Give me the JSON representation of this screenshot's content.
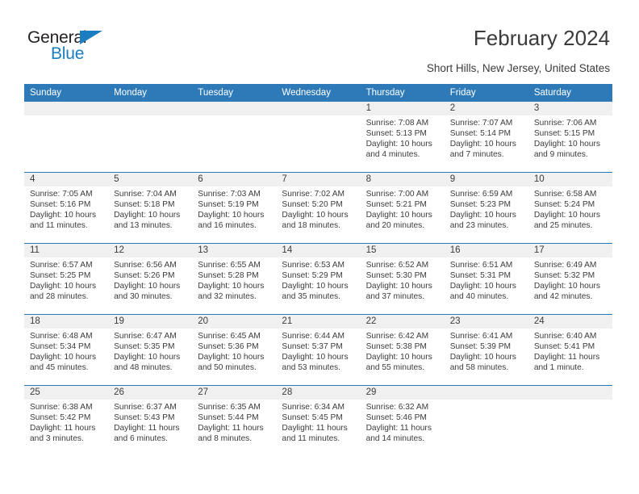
{
  "brand": {
    "name_top": "General",
    "name_bottom": "Blue",
    "accent_color": "#1a7ec1"
  },
  "header": {
    "title": "February 2024",
    "subtitle": "Short Hills, New Jersey, United States"
  },
  "calendar": {
    "header_color": "#2e7ab8",
    "daynum_band_color": "#f0f0f0",
    "weekday_headers": [
      "Sunday",
      "Monday",
      "Tuesday",
      "Wednesday",
      "Thursday",
      "Friday",
      "Saturday"
    ],
    "weeks": [
      [
        {
          "day": "",
          "sunrise": "",
          "sunset": "",
          "daylight": "",
          "empty": true
        },
        {
          "day": "",
          "sunrise": "",
          "sunset": "",
          "daylight": "",
          "empty": true
        },
        {
          "day": "",
          "sunrise": "",
          "sunset": "",
          "daylight": "",
          "empty": true
        },
        {
          "day": "",
          "sunrise": "",
          "sunset": "",
          "daylight": "",
          "empty": true
        },
        {
          "day": "1",
          "sunrise": "Sunrise: 7:08 AM",
          "sunset": "Sunset: 5:13 PM",
          "daylight": "Daylight: 10 hours and 4 minutes.",
          "empty": false
        },
        {
          "day": "2",
          "sunrise": "Sunrise: 7:07 AM",
          "sunset": "Sunset: 5:14 PM",
          "daylight": "Daylight: 10 hours and 7 minutes.",
          "empty": false
        },
        {
          "day": "3",
          "sunrise": "Sunrise: 7:06 AM",
          "sunset": "Sunset: 5:15 PM",
          "daylight": "Daylight: 10 hours and 9 minutes.",
          "empty": false
        }
      ],
      [
        {
          "day": "4",
          "sunrise": "Sunrise: 7:05 AM",
          "sunset": "Sunset: 5:16 PM",
          "daylight": "Daylight: 10 hours and 11 minutes.",
          "empty": false
        },
        {
          "day": "5",
          "sunrise": "Sunrise: 7:04 AM",
          "sunset": "Sunset: 5:18 PM",
          "daylight": "Daylight: 10 hours and 13 minutes.",
          "empty": false
        },
        {
          "day": "6",
          "sunrise": "Sunrise: 7:03 AM",
          "sunset": "Sunset: 5:19 PM",
          "daylight": "Daylight: 10 hours and 16 minutes.",
          "empty": false
        },
        {
          "day": "7",
          "sunrise": "Sunrise: 7:02 AM",
          "sunset": "Sunset: 5:20 PM",
          "daylight": "Daylight: 10 hours and 18 minutes.",
          "empty": false
        },
        {
          "day": "8",
          "sunrise": "Sunrise: 7:00 AM",
          "sunset": "Sunset: 5:21 PM",
          "daylight": "Daylight: 10 hours and 20 minutes.",
          "empty": false
        },
        {
          "day": "9",
          "sunrise": "Sunrise: 6:59 AM",
          "sunset": "Sunset: 5:23 PM",
          "daylight": "Daylight: 10 hours and 23 minutes.",
          "empty": false
        },
        {
          "day": "10",
          "sunrise": "Sunrise: 6:58 AM",
          "sunset": "Sunset: 5:24 PM",
          "daylight": "Daylight: 10 hours and 25 minutes.",
          "empty": false
        }
      ],
      [
        {
          "day": "11",
          "sunrise": "Sunrise: 6:57 AM",
          "sunset": "Sunset: 5:25 PM",
          "daylight": "Daylight: 10 hours and 28 minutes.",
          "empty": false
        },
        {
          "day": "12",
          "sunrise": "Sunrise: 6:56 AM",
          "sunset": "Sunset: 5:26 PM",
          "daylight": "Daylight: 10 hours and 30 minutes.",
          "empty": false
        },
        {
          "day": "13",
          "sunrise": "Sunrise: 6:55 AM",
          "sunset": "Sunset: 5:28 PM",
          "daylight": "Daylight: 10 hours and 32 minutes.",
          "empty": false
        },
        {
          "day": "14",
          "sunrise": "Sunrise: 6:53 AM",
          "sunset": "Sunset: 5:29 PM",
          "daylight": "Daylight: 10 hours and 35 minutes.",
          "empty": false
        },
        {
          "day": "15",
          "sunrise": "Sunrise: 6:52 AM",
          "sunset": "Sunset: 5:30 PM",
          "daylight": "Daylight: 10 hours and 37 minutes.",
          "empty": false
        },
        {
          "day": "16",
          "sunrise": "Sunrise: 6:51 AM",
          "sunset": "Sunset: 5:31 PM",
          "daylight": "Daylight: 10 hours and 40 minutes.",
          "empty": false
        },
        {
          "day": "17",
          "sunrise": "Sunrise: 6:49 AM",
          "sunset": "Sunset: 5:32 PM",
          "daylight": "Daylight: 10 hours and 42 minutes.",
          "empty": false
        }
      ],
      [
        {
          "day": "18",
          "sunrise": "Sunrise: 6:48 AM",
          "sunset": "Sunset: 5:34 PM",
          "daylight": "Daylight: 10 hours and 45 minutes.",
          "empty": false
        },
        {
          "day": "19",
          "sunrise": "Sunrise: 6:47 AM",
          "sunset": "Sunset: 5:35 PM",
          "daylight": "Daylight: 10 hours and 48 minutes.",
          "empty": false
        },
        {
          "day": "20",
          "sunrise": "Sunrise: 6:45 AM",
          "sunset": "Sunset: 5:36 PM",
          "daylight": "Daylight: 10 hours and 50 minutes.",
          "empty": false
        },
        {
          "day": "21",
          "sunrise": "Sunrise: 6:44 AM",
          "sunset": "Sunset: 5:37 PM",
          "daylight": "Daylight: 10 hours and 53 minutes.",
          "empty": false
        },
        {
          "day": "22",
          "sunrise": "Sunrise: 6:42 AM",
          "sunset": "Sunset: 5:38 PM",
          "daylight": "Daylight: 10 hours and 55 minutes.",
          "empty": false
        },
        {
          "day": "23",
          "sunrise": "Sunrise: 6:41 AM",
          "sunset": "Sunset: 5:39 PM",
          "daylight": "Daylight: 10 hours and 58 minutes.",
          "empty": false
        },
        {
          "day": "24",
          "sunrise": "Sunrise: 6:40 AM",
          "sunset": "Sunset: 5:41 PM",
          "daylight": "Daylight: 11 hours and 1 minute.",
          "empty": false
        }
      ],
      [
        {
          "day": "25",
          "sunrise": "Sunrise: 6:38 AM",
          "sunset": "Sunset: 5:42 PM",
          "daylight": "Daylight: 11 hours and 3 minutes.",
          "empty": false
        },
        {
          "day": "26",
          "sunrise": "Sunrise: 6:37 AM",
          "sunset": "Sunset: 5:43 PM",
          "daylight": "Daylight: 11 hours and 6 minutes.",
          "empty": false
        },
        {
          "day": "27",
          "sunrise": "Sunrise: 6:35 AM",
          "sunset": "Sunset: 5:44 PM",
          "daylight": "Daylight: 11 hours and 8 minutes.",
          "empty": false
        },
        {
          "day": "28",
          "sunrise": "Sunrise: 6:34 AM",
          "sunset": "Sunset: 5:45 PM",
          "daylight": "Daylight: 11 hours and 11 minutes.",
          "empty": false
        },
        {
          "day": "29",
          "sunrise": "Sunrise: 6:32 AM",
          "sunset": "Sunset: 5:46 PM",
          "daylight": "Daylight: 11 hours and 14 minutes.",
          "empty": false
        },
        {
          "day": "",
          "sunrise": "",
          "sunset": "",
          "daylight": "",
          "empty": true
        },
        {
          "day": "",
          "sunrise": "",
          "sunset": "",
          "daylight": "",
          "empty": true
        }
      ]
    ]
  }
}
